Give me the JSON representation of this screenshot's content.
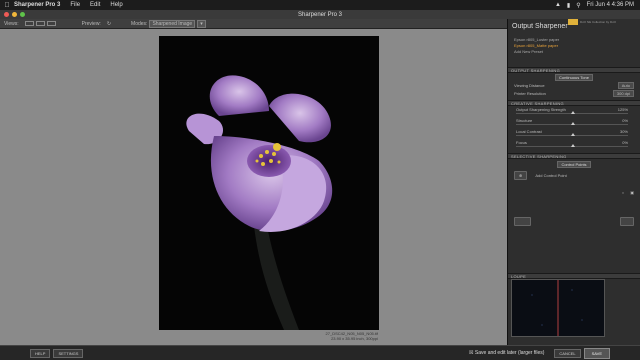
{
  "menubar": {
    "app_name": "Sharpener Pro 3",
    "items": [
      "File",
      "Edit",
      "Help"
    ],
    "clock": "Fri Jun 4  4:36 PM"
  },
  "window": {
    "title": "Sharpener Pro 3"
  },
  "toolbar": {
    "views_label": "Views:",
    "preview_label": "Preview:",
    "modes_label": "Modes:",
    "mode_value": "Sharpened Image"
  },
  "image": {
    "filename": "27_DSC42_N05_N05_N05.tif",
    "dimensions": "23.90 x 35.95 inch, 300ppi"
  },
  "panel": {
    "title": "Output Sharpener",
    "badge_text": "DxO Nik Collection by DxO",
    "presets": [
      "Epson r805_Luster paper",
      "Epson r805_Matte paper",
      "Add New Preset"
    ],
    "sections": {
      "output": "Output Sharpening",
      "creative": "Creative Sharpening",
      "selective": "Selective Sharpening",
      "loupe": "Loupe"
    },
    "output_type": "Continuous Tone",
    "viewing_distance_label": "Viewing Distance",
    "viewing_distance_value": "Auto",
    "printer_resolution_label": "Printer Resolution",
    "printer_resolution_value": "300 dpi",
    "sliders": [
      {
        "label": "Output Sharpening Strength",
        "value": "125%",
        "position": 0.5
      },
      {
        "label": "Structure",
        "value": "0%",
        "position": 0.5
      },
      {
        "label": "Local Contrast",
        "value": "30%",
        "position": 0.5
      },
      {
        "label": "Focus",
        "value": "0%",
        "position": 0.5
      }
    ],
    "control_points_label": "Control Points",
    "add_control_point": "Add Control Point"
  },
  "bottom": {
    "help": "HELP",
    "settings": "SETTINGS",
    "save_later": "Save and edit later (larger files)",
    "cancel": "CANCEL",
    "save": "SAVE"
  }
}
